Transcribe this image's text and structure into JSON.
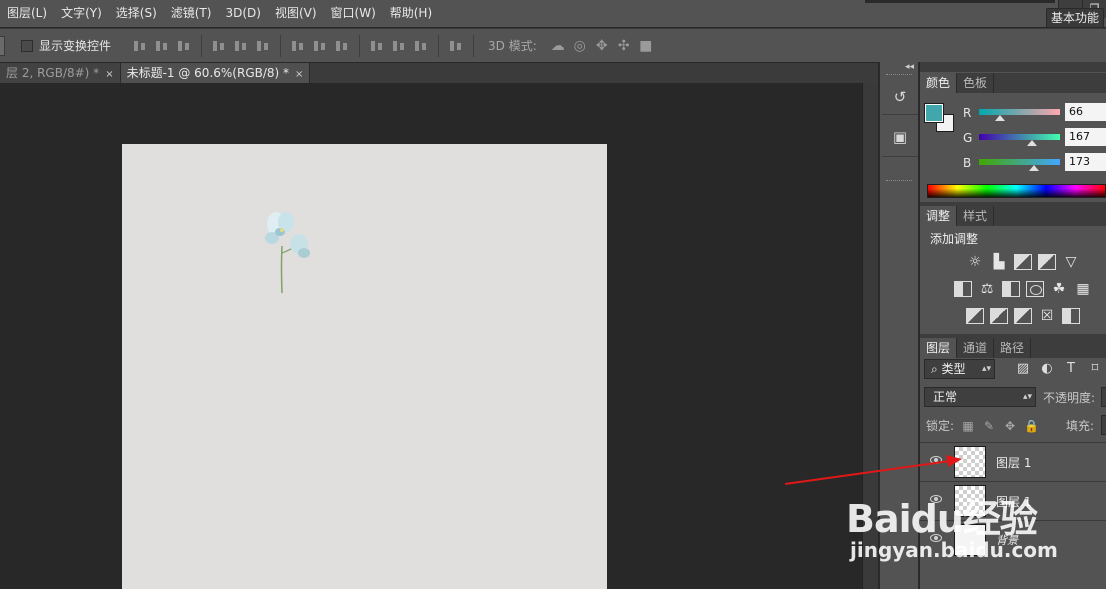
{
  "menubar": {
    "items": [
      "图层(L)",
      "文字(Y)",
      "选择(S)",
      "滤镜(T)",
      "3D(D)",
      "视图(V)",
      "窗口(W)",
      "帮助(H)"
    ],
    "window_controls": [
      "—",
      "❐"
    ]
  },
  "options_bar": {
    "show_transform_label": "显示变换控件",
    "show_transform_checked": false,
    "mode_3d_label": "3D 模式:",
    "mode_3d_icons": [
      "orbit-icon",
      "roll-icon",
      "pan-icon",
      "slide-icon",
      "camera-icon"
    ],
    "workspace_label": "基本功能"
  },
  "tabs": [
    {
      "label": "层 2, RGB/8#) *",
      "close": "×",
      "active": false
    },
    {
      "label": "未标题-1 @ 60.6%(RGB/8) *",
      "close": "×",
      "active": true
    }
  ],
  "color_panel": {
    "tabs": [
      "颜色",
      "色板"
    ],
    "foreground_color": "#42a7ad",
    "background_color": "#f2f2f2",
    "channels": [
      {
        "name": "R",
        "value": "66",
        "fraction": 0.259
      },
      {
        "name": "G",
        "value": "167",
        "fraction": 0.655
      },
      {
        "name": "B",
        "value": "173",
        "fraction": 0.678
      }
    ]
  },
  "adjustments_panel": {
    "tabs": [
      "调整",
      "样式"
    ],
    "heading": "添加调整",
    "icon_rows": [
      [
        "brightness-contrast-icon",
        "levels-icon",
        "curves-icon",
        "exposure-icon",
        "vibrance-icon"
      ],
      [
        "hue-saturation-icon",
        "color-balance-icon",
        "black-white-icon",
        "photo-filter-icon",
        "channel-mixer-icon",
        "color-lookup-icon"
      ],
      [
        "invert-icon",
        "posterize-icon",
        "threshold-icon",
        "selective-color-icon",
        "gradient-map-icon"
      ]
    ]
  },
  "layers_panel": {
    "tabs": [
      "图层",
      "通道",
      "路径"
    ],
    "filter_label": "⌕ 类型",
    "filter_icons": [
      "image-filter-icon",
      "adjustment-filter-icon",
      "type-filter-icon",
      "shape-filter-icon"
    ],
    "blend_mode": "正常",
    "opacity_label": "不透明度:",
    "lock_label": "锁定:",
    "fill_label": "填充:",
    "layers": [
      {
        "name": "图层 1",
        "visible": true,
        "thumbnail": "transparent"
      },
      {
        "name": "图层 1",
        "visible": true,
        "thumbnail": "transparent"
      },
      {
        "name": "背景",
        "visible": true,
        "thumbnail": "white"
      }
    ]
  },
  "watermark": {
    "logo": "Baidu经验",
    "url": "jingyan.baidu.com"
  }
}
